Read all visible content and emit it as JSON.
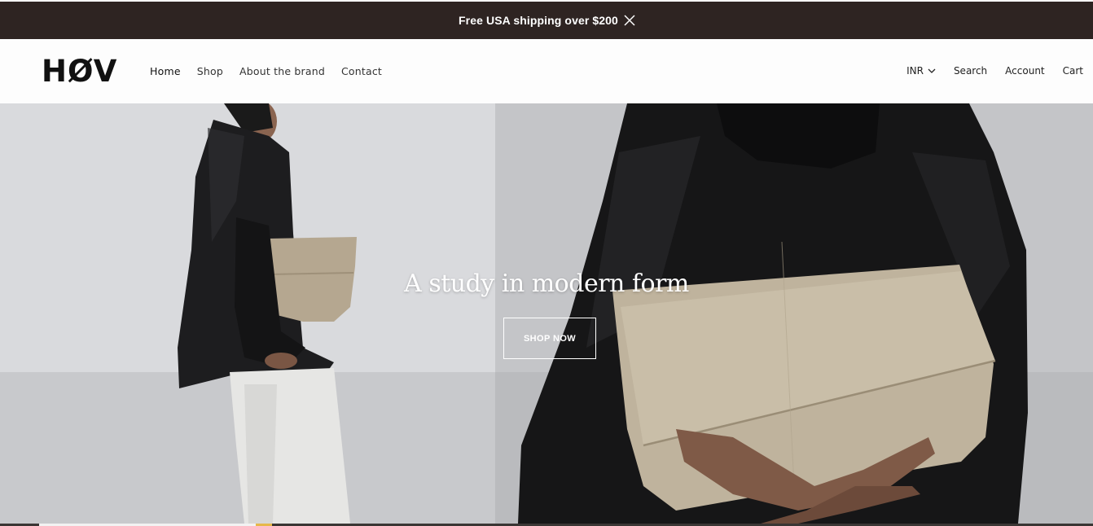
{
  "announcement": {
    "text": "Free USA shipping over $200",
    "close_icon": "close-icon"
  },
  "header": {
    "logo": "HØV",
    "nav": [
      {
        "label": "Home"
      },
      {
        "label": "Shop"
      },
      {
        "label": "About the brand"
      },
      {
        "label": "Contact"
      }
    ],
    "currency": "INR",
    "search_label": "Search",
    "account_label": "Account",
    "cart_label": "Cart"
  },
  "hero": {
    "title": "A study in modern form",
    "cta_label": "SHOP NOW"
  },
  "colors": {
    "announcement_bg": "#2e2422",
    "header_bg": "#fdfdfd",
    "hero_text": "#ffffff"
  }
}
